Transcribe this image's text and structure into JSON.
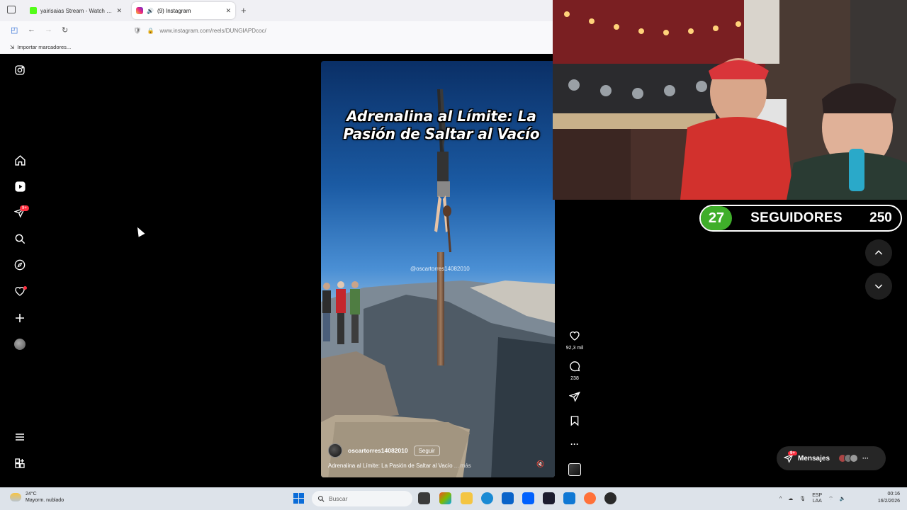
{
  "browser": {
    "tabs": [
      {
        "label": "yairisaias Stream - Watch Live o",
        "icon": "kick-favicon",
        "active": false
      },
      {
        "label": "(9) Instagram",
        "icon": "instagram-favicon",
        "active": true
      }
    ],
    "url": "www.instagram.com/reels/DUNGIAPDcoc/",
    "bookmarks_label": "Importar marcadores..."
  },
  "sidebar": {
    "icons": [
      "instagram-logo-icon",
      "home-icon",
      "reels-icon",
      "messages-icon",
      "search-icon",
      "explore-icon",
      "notifications-icon",
      "create-icon",
      "profile-avatar",
      "menu-icon",
      "more-apps-icon"
    ],
    "messages_badge": "9+"
  },
  "reel": {
    "title": "Adrenalina al Límite: La Pasión de Saltar al Vacío",
    "watermark": "@oscartorres14082010",
    "username": "oscartorres14082010",
    "follow_label": "Seguir",
    "caption": "Adrenalina al Límite: La Pasión de Saltar al Vacío",
    "more_label": "... más",
    "likes": "92,3 mil",
    "comments": "238"
  },
  "overlay": {
    "followers_current": "27",
    "followers_label": "SEGUIDORES",
    "followers_goal": "250"
  },
  "messages": {
    "label": "Mensajes",
    "badge": "9+"
  },
  "taskbar": {
    "temperature": "24°C",
    "weather": "Mayorm. nublado",
    "search_placeholder": "Buscar",
    "lang_top": "ESP",
    "lang_bottom": "LAA",
    "time": "00:16",
    "date": "16/2/2026"
  },
  "colors": {
    "followers_green": "#3fae2a",
    "notification_red": "#ff3040",
    "windows_blue": "#0a6cd8"
  }
}
